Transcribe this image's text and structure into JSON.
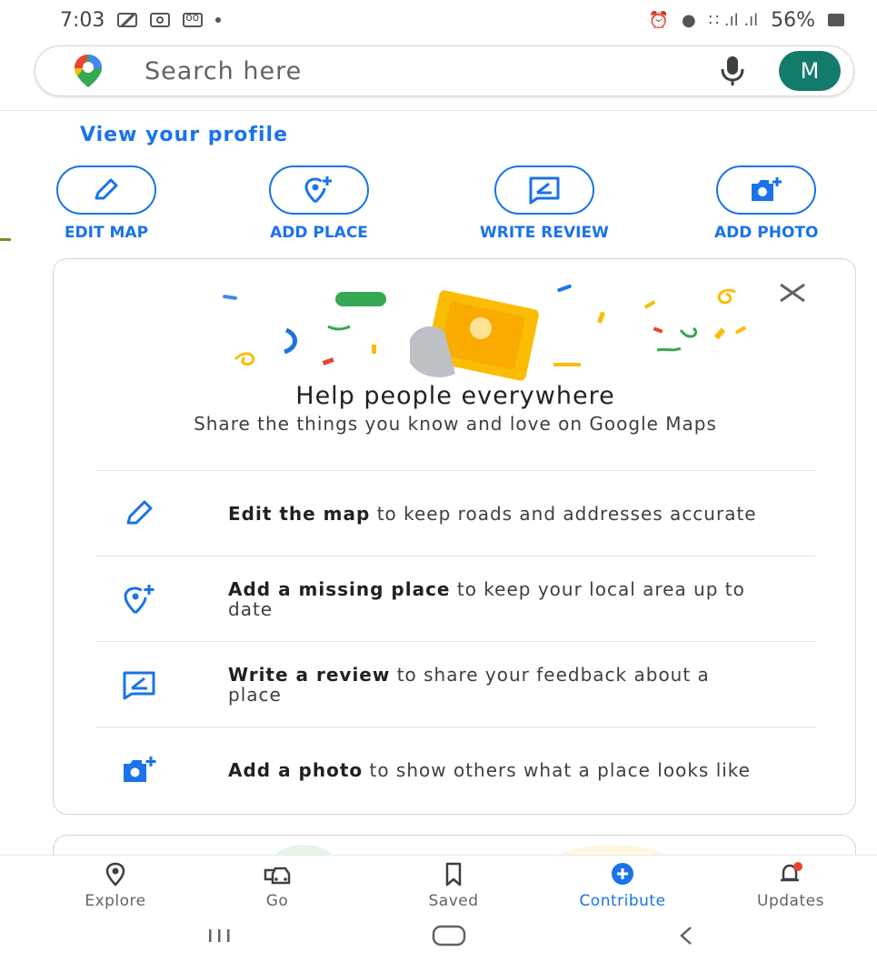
{
  "status_bar": {
    "time": "7:03",
    "battery": "56%",
    "signal_glyphs": "∷ .ıl .ıl"
  },
  "search": {
    "placeholder": "Search here",
    "avatar_initial": "M"
  },
  "profile": {
    "link_label": "View your profile"
  },
  "quick_actions": [
    {
      "label": "EDIT MAP",
      "icon": "pencil-icon"
    },
    {
      "label": "ADD PLACE",
      "icon": "add-place-icon"
    },
    {
      "label": "WRITE REVIEW",
      "icon": "review-icon"
    },
    {
      "label": "ADD PHOTO",
      "icon": "add-photo-icon"
    }
  ],
  "card": {
    "title": "Help people everywhere",
    "subtitle": "Share the things you know and love on Google Maps",
    "rows": [
      {
        "bold": "Edit the map",
        "rest": " to keep roads and addresses accurate",
        "icon": "pencil-icon"
      },
      {
        "bold": "Add a missing place",
        "rest": " to keep your local area up to date",
        "icon": "add-place-icon"
      },
      {
        "bold": "Write a review",
        "rest": " to share your feedback about a place",
        "icon": "review-icon"
      },
      {
        "bold": "Add a photo",
        "rest": " to show others what a place looks like",
        "icon": "add-photo-icon"
      }
    ]
  },
  "bottom_nav": {
    "items": [
      {
        "label": "Explore",
        "icon": "explore-pin-icon"
      },
      {
        "label": "Go",
        "icon": "car-icon"
      },
      {
        "label": "Saved",
        "icon": "bookmark-icon"
      },
      {
        "label": "Contribute",
        "icon": "plus-circle-icon",
        "active": true
      },
      {
        "label": "Updates",
        "icon": "bell-icon"
      }
    ]
  },
  "colors": {
    "accent": "#1a73e8",
    "avatar": "#137b6b",
    "notification_dot": "#ea4335"
  }
}
